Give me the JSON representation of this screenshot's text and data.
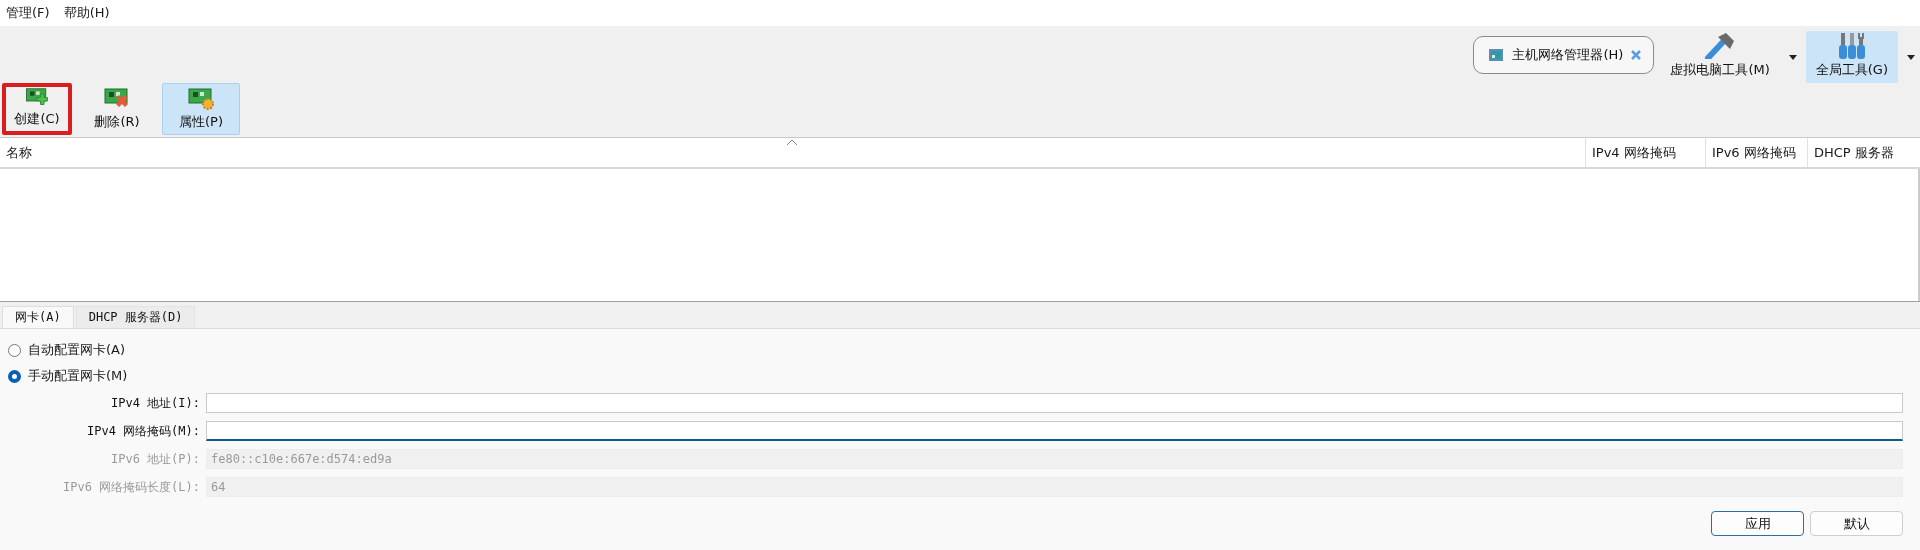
{
  "menu": [
    "管理(F)",
    "帮助(H)"
  ],
  "tool_tabs": [
    {
      "label": "主机网络管理器(H)",
      "kind": "pill",
      "selected": false
    },
    {
      "label": "虚拟电脑工具(M)",
      "kind": "hammer",
      "selected": false
    },
    {
      "label": "全局工具(G)",
      "kind": "tools",
      "selected": true
    }
  ],
  "actions": [
    {
      "label": "创建(C)",
      "kind": "create",
      "selected": false,
      "highlighted": true
    },
    {
      "label": "删除(R)",
      "kind": "delete",
      "selected": false,
      "highlighted": false
    },
    {
      "label": "属性(P)",
      "kind": "properties",
      "selected": true,
      "highlighted": false
    }
  ],
  "table": {
    "columns": [
      "名称",
      "IPv4 网络掩码",
      "IPv6 网络掩码",
      "DHCP 服务器"
    ]
  },
  "tabs": [
    {
      "label": "网卡(A)",
      "selected": true
    },
    {
      "label": "DHCP 服务器(D)",
      "selected": false
    }
  ],
  "radios": [
    {
      "label": "自动配置网卡(A)",
      "selected": false
    },
    {
      "label": "手动配置网卡(M)",
      "selected": true
    }
  ],
  "fields": [
    {
      "label": "IPv4 地址(I):",
      "disabled": false,
      "focused": false
    },
    {
      "label": "IPv4 网络掩码(M):",
      "disabled": false,
      "focused": true
    },
    {
      "label": "IPv6 地址(P):",
      "value": "fe80::c10e:667e:d574:ed9a",
      "disabled": true,
      "focused": false
    },
    {
      "label": "IPv6 网络掩码长度(L):",
      "value": "64",
      "disabled": true,
      "focused": false
    }
  ],
  "buttons": [
    {
      "label": "应用",
      "kind": "default"
    },
    {
      "label": "默认",
      "kind": "normal"
    }
  ]
}
